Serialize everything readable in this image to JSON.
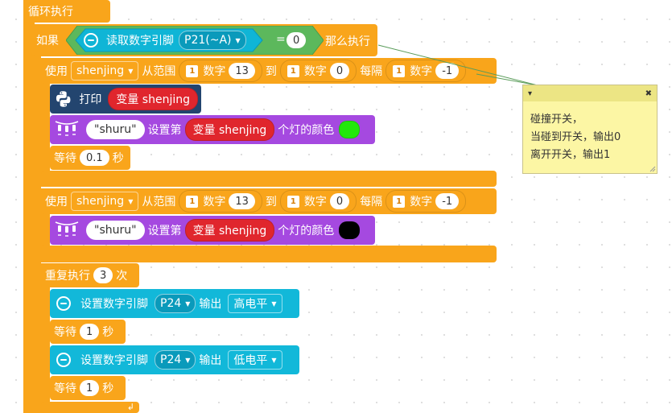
{
  "loop": {
    "label": "循环执行"
  },
  "if_block": {
    "if_label": "如果",
    "read_label": "读取数字引脚",
    "pin": "P21(~A)",
    "op": "=",
    "value": "0",
    "then_label": "那么执行"
  },
  "for1": {
    "use_label": "使用",
    "var": "shenjing",
    "range_label": "从范围",
    "num_label": "数字",
    "num_icon": "1",
    "from": "13",
    "to_label": "到",
    "to": "0",
    "step_label": "每隔",
    "step": "-1"
  },
  "print_block": {
    "label": "打印",
    "var_label": "变量 shenjing"
  },
  "color1": {
    "strip": "\"shuru\"",
    "set_label": "设置第",
    "var_label": "变量 shenjing",
    "color_label": "个灯的颜色",
    "color": "#22e80a"
  },
  "wait1": {
    "label": "等待",
    "value": "0.1",
    "unit": "秒"
  },
  "for2": {
    "use_label": "使用",
    "var": "shenjing",
    "range_label": "从范围",
    "num_label": "数字",
    "num_icon": "1",
    "from": "13",
    "to_label": "到",
    "to": "0",
    "step_label": "每隔",
    "step": "-1"
  },
  "color2": {
    "strip": "\"shuru\"",
    "set_label": "设置第",
    "var_label": "变量 shenjing",
    "color_label": "个灯的颜色",
    "color": "#000000"
  },
  "repeat": {
    "label": "重复执行",
    "count": "3",
    "times_label": "次"
  },
  "pin_set1": {
    "label": "设置数字引脚",
    "pin": "P24",
    "out_label": "输出",
    "level": "高电平"
  },
  "wait2": {
    "label": "等待",
    "value": "1",
    "unit": "秒"
  },
  "pin_set2": {
    "label": "设置数字引脚",
    "pin": "P24",
    "out_label": "输出",
    "level": "低电平"
  },
  "wait3": {
    "label": "等待",
    "value": "1",
    "unit": "秒"
  },
  "comment": {
    "lines": [
      "碰撞开关，",
      "当碰到开关，输出0",
      "离开开关，输出1"
    ],
    "collapse_icon": "▾",
    "close_icon": "✖"
  },
  "colors": {
    "orange": "#f9a51b",
    "teal": "#0fb5d6",
    "purple": "#a549e0",
    "red": "#e0262d",
    "navy": "#23456f",
    "green_if": "#5cb85c",
    "comment_bg": "#fcf6a4"
  }
}
